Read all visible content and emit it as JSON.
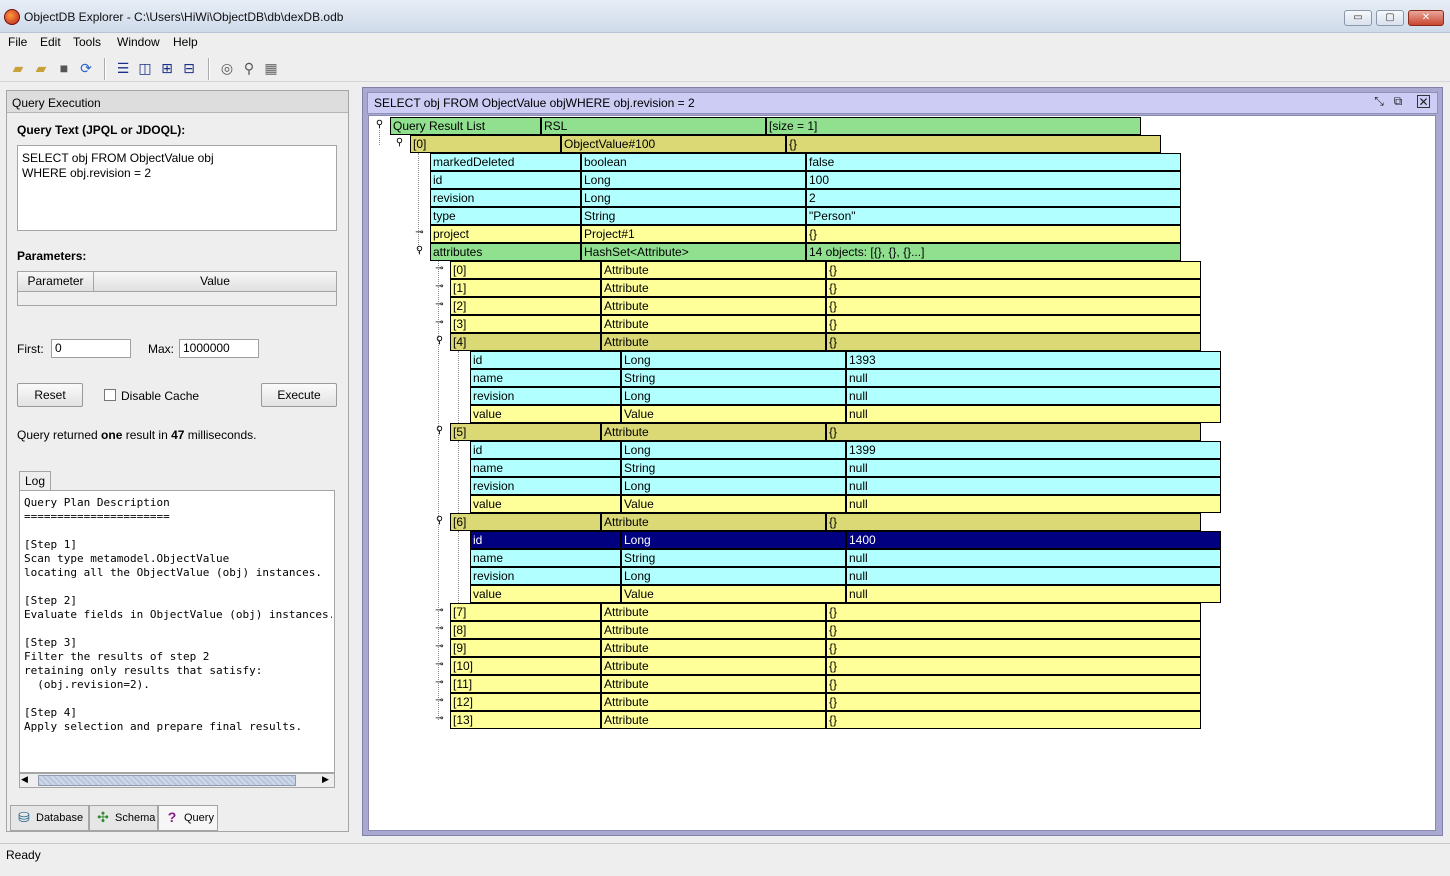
{
  "window": {
    "title": "ObjectDB Explorer - C:\\Users\\HiWi\\ObjectDB\\db\\dexDB.odb",
    "minimize": "▭",
    "maximize": "▢",
    "close": "✕"
  },
  "menu": {
    "file": "File",
    "edit": "Edit",
    "tools": "Tools",
    "window": "Window",
    "help": "Help"
  },
  "toolbar": {
    "icons": [
      "open-folder-icon",
      "open-recent-icon",
      "save-icon",
      "refresh-icon",
      "horizontal-split-icon",
      "vertical-split-icon",
      "tree-icon",
      "tree-expand-icon",
      "settings-icon",
      "search-icon",
      "table-icon"
    ]
  },
  "left_panel": {
    "title": "Query Execution",
    "query_label": "Query Text (JPQL or JDOQL):",
    "query_text": "SELECT obj FROM ObjectValue obj\nWHERE obj.revision = 2",
    "params_label": "Parameters:",
    "params_headers": [
      "Parameter",
      "Value"
    ],
    "first_label": "First:",
    "first_value": "0",
    "max_label": "Max:",
    "max_value": "1000000",
    "reset_label": "Reset",
    "disable_cache_label": "Disable Cache",
    "execute_label": "Execute",
    "result_pre": "Query returned ",
    "result_count": "one",
    "result_mid": " result in ",
    "result_ms": "47",
    "result_post": " milliseconds.",
    "log_tab": "Log",
    "log_text": "Query Plan Description\n======================\n\n[Step 1]\nScan type metamodel.ObjectValue\nlocating all the ObjectValue (obj) instances.\n\n[Step 2]\nEvaluate fields in ObjectValue (obj) instances.\n\n[Step 3]\nFilter the results of step 2\nretaining only results that satisfy:\n  (obj.revision=2).\n\n[Step 4]\nApply selection and prepare final results.",
    "tabs": [
      {
        "label": "Database",
        "icon": "database-icon"
      },
      {
        "label": "Schema",
        "icon": "schema-icon"
      },
      {
        "label": "Query",
        "icon": "question-icon"
      }
    ]
  },
  "right_panel": {
    "title": "SELECT obj FROM ObjectValue objWHERE obj.revision = 2",
    "header_icons": [
      "restore-window-icon",
      "detach-window-icon",
      "close-window-icon"
    ],
    "tree": {
      "root": [
        "Query Result List",
        "RSL",
        "[size = 1]"
      ],
      "item0": [
        "[0]",
        "ObjectValue#100",
        "{}"
      ],
      "fields": [
        {
          "name": "markedDeleted",
          "type": "boolean",
          "value": "false",
          "kind": "cyan"
        },
        {
          "name": "id",
          "type": "Long",
          "value": "100",
          "kind": "cyan"
        },
        {
          "name": "revision",
          "type": "Long",
          "value": "2",
          "kind": "cyan"
        },
        {
          "name": "type",
          "type": "String",
          "value": "\"Person\"",
          "kind": "cyan"
        },
        {
          "name": "project",
          "type": "Project#1",
          "value": "{}",
          "kind": "yellow",
          "toggle": "collapsed"
        },
        {
          "name": "attributes",
          "type": "HashSet<Attribute>",
          "value": "14 objects: [{}, {}, {}...]",
          "kind": "green",
          "toggle": "expanded"
        }
      ],
      "attributes": [
        {
          "index": "[0]",
          "type": "Attribute",
          "value": "{}"
        },
        {
          "index": "[1]",
          "type": "Attribute",
          "value": "{}"
        },
        {
          "index": "[2]",
          "type": "Attribute",
          "value": "{}"
        },
        {
          "index": "[3]",
          "type": "Attribute",
          "value": "{}"
        },
        {
          "index": "[4]",
          "type": "Attribute",
          "value": "{}",
          "children": [
            {
              "name": "id",
              "type": "Long",
              "value": "1393",
              "kind": "cyan"
            },
            {
              "name": "name",
              "type": "String",
              "value": "null",
              "kind": "cyan"
            },
            {
              "name": "revision",
              "type": "Long",
              "value": "null",
              "kind": "cyan"
            },
            {
              "name": "value",
              "type": "Value",
              "value": "null",
              "kind": "yellow"
            }
          ]
        },
        {
          "index": "[5]",
          "type": "Attribute",
          "value": "{}",
          "children": [
            {
              "name": "id",
              "type": "Long",
              "value": "1399",
              "kind": "cyan"
            },
            {
              "name": "name",
              "type": "String",
              "value": "null",
              "kind": "cyan"
            },
            {
              "name": "revision",
              "type": "Long",
              "value": "null",
              "kind": "cyan"
            },
            {
              "name": "value",
              "type": "Value",
              "value": "null",
              "kind": "yellow"
            }
          ]
        },
        {
          "index": "[6]",
          "type": "Attribute",
          "value": "{}",
          "children": [
            {
              "name": "id",
              "type": "Long",
              "value": "1400",
              "kind": "selected"
            },
            {
              "name": "name",
              "type": "String",
              "value": "null",
              "kind": "cyan"
            },
            {
              "name": "revision",
              "type": "Long",
              "value": "null",
              "kind": "cyan"
            },
            {
              "name": "value",
              "type": "Value",
              "value": "null",
              "kind": "yellow"
            }
          ]
        },
        {
          "index": "[7]",
          "type": "Attribute",
          "value": "{}"
        },
        {
          "index": "[8]",
          "type": "Attribute",
          "value": "{}"
        },
        {
          "index": "[9]",
          "type": "Attribute",
          "value": "{}"
        },
        {
          "index": "[10]",
          "type": "Attribute",
          "value": "{}"
        },
        {
          "index": "[11]",
          "type": "Attribute",
          "value": "{}"
        },
        {
          "index": "[12]",
          "type": "Attribute",
          "value": "{}"
        },
        {
          "index": "[13]",
          "type": "Attribute",
          "value": "{}"
        }
      ]
    }
  },
  "status": {
    "text": "Ready"
  }
}
